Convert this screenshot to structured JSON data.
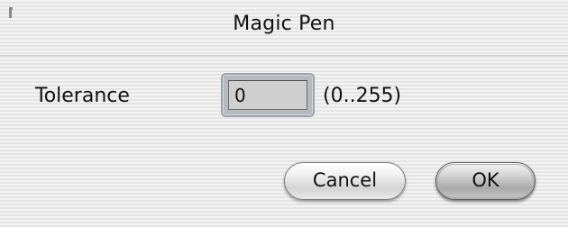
{
  "dialog": {
    "title": "Magic Pen"
  },
  "tolerance": {
    "label": "Tolerance",
    "value": "0",
    "range_hint": "(0..255)"
  },
  "buttons": {
    "cancel_label": "Cancel",
    "ok_label": "OK"
  }
}
